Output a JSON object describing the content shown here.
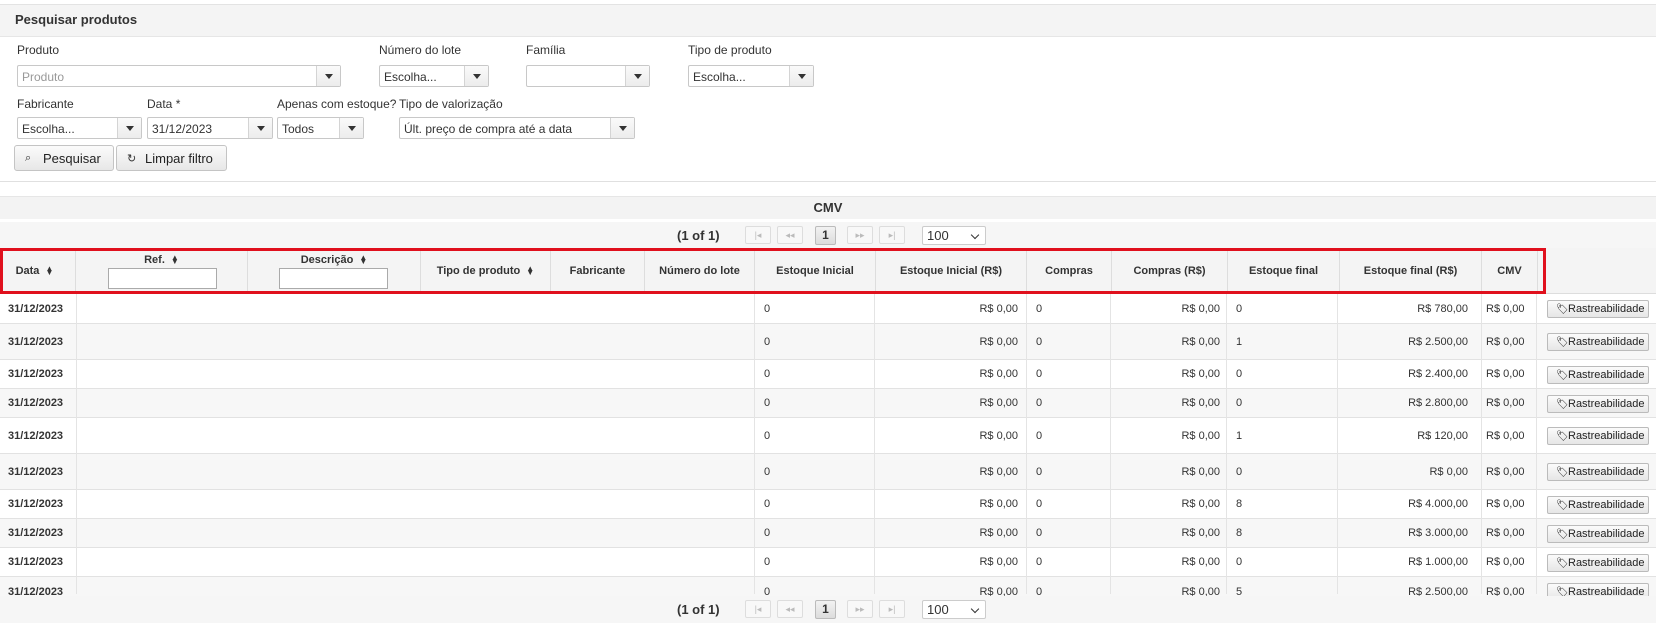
{
  "panel": {
    "title": "Pesquisar produtos"
  },
  "filters": {
    "produto": {
      "label": "Produto",
      "placeholder": "Produto"
    },
    "numero_lote": {
      "label": "Número do lote",
      "value": "Escolha..."
    },
    "familia": {
      "label": "Família",
      "value": ""
    },
    "tipo_produto": {
      "label": "Tipo de produto",
      "value": "Escolha..."
    },
    "fabricante": {
      "label": "Fabricante",
      "value": "Escolha..."
    },
    "data": {
      "label": "Data",
      "required": "*",
      "value": "31/12/2023"
    },
    "apenas_estoque": {
      "label": "Apenas com estoque?",
      "value": "Todos"
    },
    "tipo_valorizacao": {
      "label": "Tipo de valorização",
      "value": "Últ. preço de compra até a data"
    }
  },
  "buttons": {
    "search": "Pesquisar",
    "clear": "Limpar filtro"
  },
  "table": {
    "caption": "CMV",
    "pager": {
      "text": "(1 of 1)",
      "current": "1",
      "per_page": "100",
      "first": "|◂",
      "prev": "◂◂",
      "next": "▸▸",
      "last": "▸|"
    },
    "headers": {
      "data": "Data",
      "ref": "Ref.",
      "descricao": "Descrição",
      "tipo_produto": "Tipo de produto",
      "fabricante": "Fabricante",
      "numero_lote": "Número do lote",
      "estoque_inicial": "Estoque Inicial",
      "estoque_inicial_rs": "Estoque Inicial (R$)",
      "compras": "Compras",
      "compras_rs": "Compras (R$)",
      "estoque_final": "Estoque final",
      "estoque_final_rs": "Estoque final (R$)",
      "cmv": "CMV"
    },
    "action_label": "Rastreabilidade",
    "rows": [
      {
        "data": "31/12/2023",
        "estoque_inicial": "0",
        "estoque_inicial_rs": "R$ 0,00",
        "compras": "0",
        "compras_rs": "R$ 0,00",
        "estoque_final": "0",
        "estoque_final_rs": "R$ 780,00",
        "cmv": "R$ 0,00"
      },
      {
        "data": "31/12/2023",
        "estoque_inicial": "0",
        "estoque_inicial_rs": "R$ 0,00",
        "compras": "0",
        "compras_rs": "R$ 0,00",
        "estoque_final": "1",
        "estoque_final_rs": "R$ 2.500,00",
        "cmv": "R$ 0,00"
      },
      {
        "data": "31/12/2023",
        "estoque_inicial": "0",
        "estoque_inicial_rs": "R$ 0,00",
        "compras": "0",
        "compras_rs": "R$ 0,00",
        "estoque_final": "0",
        "estoque_final_rs": "R$ 2.400,00",
        "cmv": "R$ 0,00"
      },
      {
        "data": "31/12/2023",
        "estoque_inicial": "0",
        "estoque_inicial_rs": "R$ 0,00",
        "compras": "0",
        "compras_rs": "R$ 0,00",
        "estoque_final": "0",
        "estoque_final_rs": "R$ 2.800,00",
        "cmv": "R$ 0,00"
      },
      {
        "data": "31/12/2023",
        "estoque_inicial": "0",
        "estoque_inicial_rs": "R$ 0,00",
        "compras": "0",
        "compras_rs": "R$ 0,00",
        "estoque_final": "1",
        "estoque_final_rs": "R$ 120,00",
        "cmv": "R$ 0,00"
      },
      {
        "data": "31/12/2023",
        "estoque_inicial": "0",
        "estoque_inicial_rs": "R$ 0,00",
        "compras": "0",
        "compras_rs": "R$ 0,00",
        "estoque_final": "0",
        "estoque_final_rs": "R$ 0,00",
        "cmv": "R$ 0,00"
      },
      {
        "data": "31/12/2023",
        "estoque_inicial": "0",
        "estoque_inicial_rs": "R$ 0,00",
        "compras": "0",
        "compras_rs": "R$ 0,00",
        "estoque_final": "8",
        "estoque_final_rs": "R$ 4.000,00",
        "cmv": "R$ 0,00"
      },
      {
        "data": "31/12/2023",
        "estoque_inicial": "0",
        "estoque_inicial_rs": "R$ 0,00",
        "compras": "0",
        "compras_rs": "R$ 0,00",
        "estoque_final": "8",
        "estoque_final_rs": "R$ 3.000,00",
        "cmv": "R$ 0,00"
      },
      {
        "data": "31/12/2023",
        "estoque_inicial": "0",
        "estoque_inicial_rs": "R$ 0,00",
        "compras": "0",
        "compras_rs": "R$ 0,00",
        "estoque_final": "0",
        "estoque_final_rs": "R$ 1.000,00",
        "cmv": "R$ 0,00"
      },
      {
        "data": "31/12/2023",
        "estoque_inicial": "0",
        "estoque_inicial_rs": "R$ 0,00",
        "compras": "0",
        "compras_rs": "R$ 0,00",
        "estoque_final": "5",
        "estoque_final_rs": "R$ 2.500,00",
        "cmv": "R$ 0,00"
      }
    ]
  },
  "colors": {
    "highlight": "#e0101d"
  }
}
